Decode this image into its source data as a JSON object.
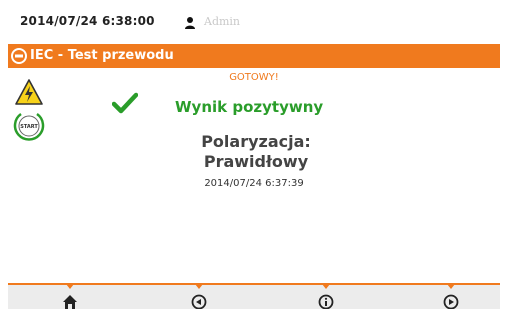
{
  "header": {
    "datetime": "2014/07/24 6:38:00",
    "user": "Admin",
    "user_icon": "user-icon"
  },
  "titlebar": {
    "title": "IEC - Test przewodu",
    "icon": "cable-test-icon"
  },
  "status": {
    "text": "GOTOWY!"
  },
  "side_icons": {
    "warning": "high-voltage-warning-icon",
    "start": "START"
  },
  "result": {
    "text": "Wynik pozytywny",
    "icon": "check-icon",
    "color": "#2a9d2a"
  },
  "measurement": {
    "name": "Polaryzacja:",
    "value": "Prawidłowy",
    "timestamp": "2014/07/24 6:37:39"
  },
  "bottom_nav": [
    {
      "icon": "home-icon"
    },
    {
      "icon": "back-icon"
    },
    {
      "icon": "info-icon"
    },
    {
      "icon": "forward-icon"
    }
  ],
  "colors": {
    "accent": "#f07a1e",
    "text_dark": "#444444",
    "muted": "#c9c9c9"
  }
}
